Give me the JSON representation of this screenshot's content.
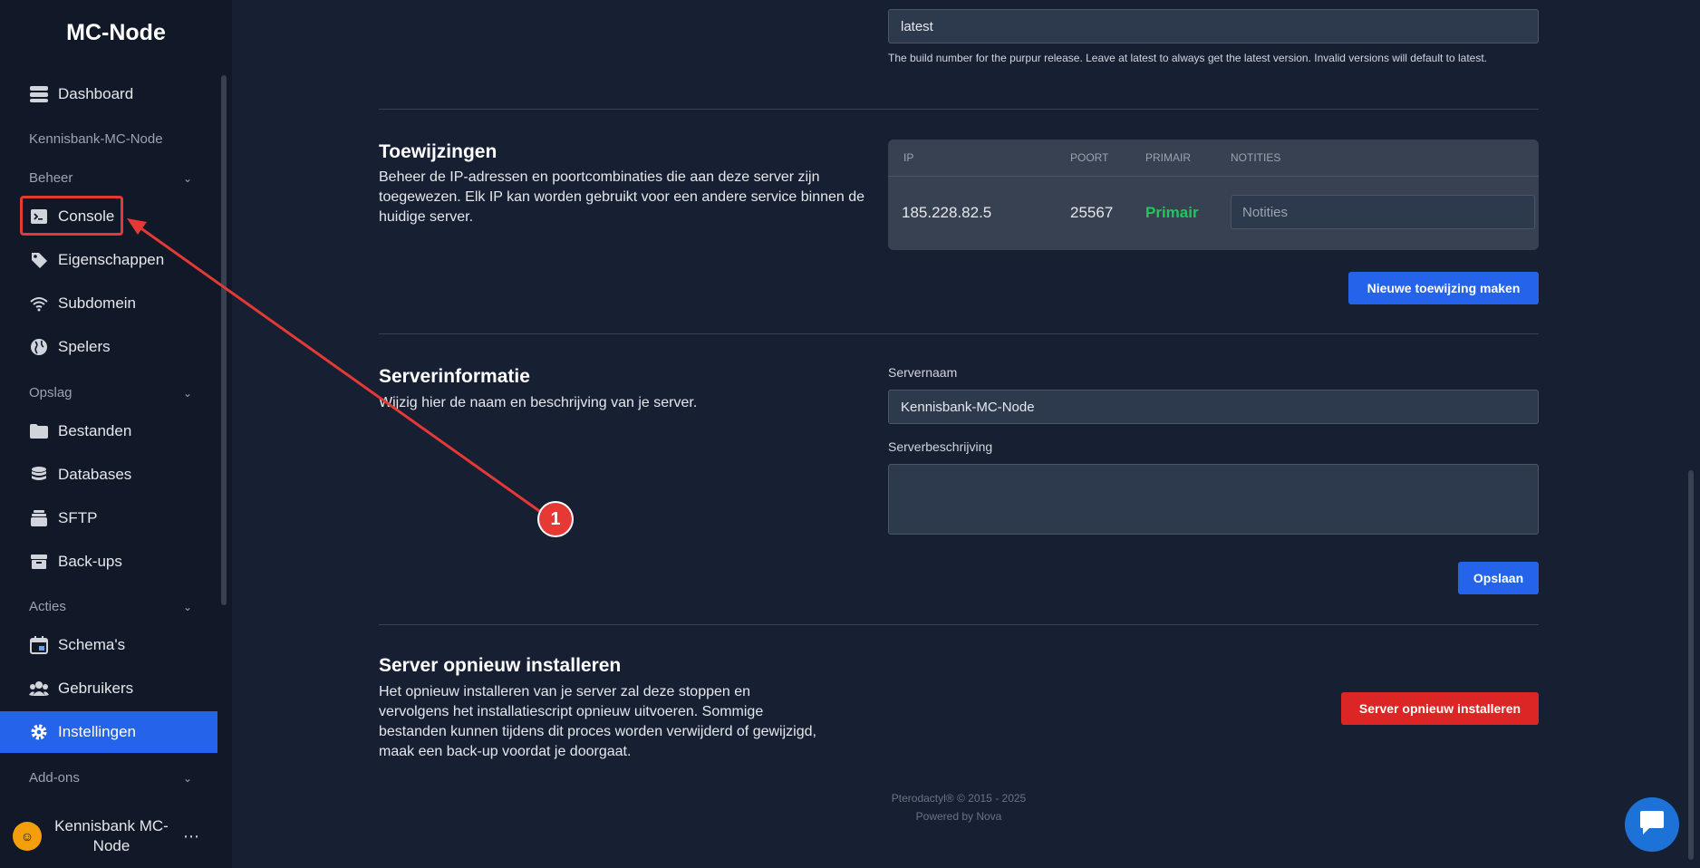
{
  "brand": "MC-Node",
  "sidebar": {
    "top_item": {
      "label": "Dashboard",
      "icon": "server-stack-icon"
    },
    "server_name": "Kennisbank-MC-Node",
    "sections": [
      {
        "label": "Beheer",
        "items": [
          {
            "label": "Console",
            "icon": "terminal-icon"
          },
          {
            "label": "Eigenschappen",
            "icon": "tag-icon"
          },
          {
            "label": "Subdomein",
            "icon": "wifi-icon"
          },
          {
            "label": "Spelers",
            "icon": "globe-icon"
          }
        ]
      },
      {
        "label": "Opslag",
        "items": [
          {
            "label": "Bestanden",
            "icon": "folder-icon"
          },
          {
            "label": "Databases",
            "icon": "database-icon"
          },
          {
            "label": "SFTP",
            "icon": "stack-icon"
          },
          {
            "label": "Back-ups",
            "icon": "archive-icon"
          }
        ]
      },
      {
        "label": "Acties",
        "items": [
          {
            "label": "Schema's",
            "icon": "calendar-icon"
          },
          {
            "label": "Gebruikers",
            "icon": "users-icon"
          },
          {
            "label": "Instellingen",
            "icon": "gear-icon",
            "active": true
          }
        ]
      },
      {
        "label": "Add-ons",
        "items": []
      }
    ],
    "user": {
      "name": "Kennisbank MC-Node",
      "more": "⋯"
    }
  },
  "build": {
    "value": "latest",
    "help": "The build number for the purpur release. Leave at latest to always get the latest version. Invalid versions will default to latest."
  },
  "allocations": {
    "title": "Toewijzingen",
    "description": "Beheer de IP-adressen en poortcombinaties die aan deze server zijn toegewezen. Elk IP kan worden gebruikt voor een andere service binnen de huidige server.",
    "columns": [
      "IP",
      "POORT",
      "PRIMAIR",
      "NOTITIES"
    ],
    "rows": [
      {
        "ip": "185.228.82.5",
        "port": "25567",
        "primary": "Primair",
        "notes_placeholder": "Notities"
      }
    ],
    "new_button": "Nieuwe toewijzing maken"
  },
  "server_info": {
    "title": "Serverinformatie",
    "description": "Wijzig hier de naam en beschrijving van je server.",
    "name_label": "Servernaam",
    "name_value": "Kennisbank-MC-Node",
    "desc_label": "Serverbeschrijving",
    "desc_value": "",
    "save_button": "Opslaan"
  },
  "reinstall": {
    "title": "Server opnieuw installeren",
    "description": "Het opnieuw installeren van je server zal deze stoppen en vervolgens het installatiescript opnieuw uitvoeren. Sommige bestanden kunnen tijdens dit proces worden verwijderd of gewijzigd, maak een back-up voordat je doorgaat.",
    "button": "Server opnieuw installeren"
  },
  "footer": {
    "line1": "Pterodactyl® © 2015 - 2025",
    "line2": "Powered by Nova"
  },
  "annotation": {
    "badge": "1"
  },
  "colors": {
    "accent": "#2563eb",
    "danger": "#dc2626",
    "success": "#22c55e",
    "annotation": "#e53935"
  }
}
